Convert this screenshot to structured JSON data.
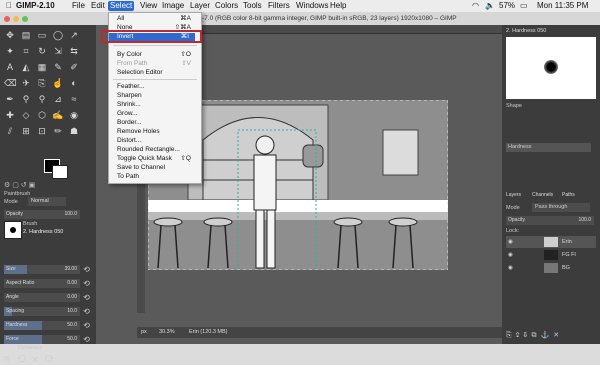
{
  "menubar": {
    "app": "GIMP-2.10",
    "items": [
      "File",
      "Edit",
      "Select",
      "View",
      "Image",
      "Layer",
      "Colors",
      "Tools",
      "Filters",
      "Windows",
      "Help"
    ],
    "active": "Select",
    "battery": "57%",
    "clock": "Mon 11:35 PM"
  },
  "titlebar": {
    "title": "-7.0 (RGB color 8-bit gamma integer, GIMP built-in sRGB, 23 layers) 1920x1080 – GIMP"
  },
  "select_menu": [
    {
      "label": "All",
      "shortcut": "⌘A"
    },
    {
      "label": "None",
      "shortcut": "⇧⌘A"
    },
    {
      "label": "Invert",
      "shortcut": "⌘I",
      "highlighted": true
    },
    {
      "label": "By Color",
      "shortcut": "⇧O"
    },
    {
      "label": "From Path",
      "shortcut": "⇧V",
      "disabled": true
    },
    {
      "label": "Selection Editor"
    },
    {
      "label": "Feather..."
    },
    {
      "label": "Sharpen"
    },
    {
      "label": "Shrink..."
    },
    {
      "label": "Grow..."
    },
    {
      "label": "Border..."
    },
    {
      "label": "Remove Holes"
    },
    {
      "label": "Distort..."
    },
    {
      "label": "Rounded Rectangle..."
    },
    {
      "label": "Toggle Quick Mask",
      "shortcut": "⇧Q"
    },
    {
      "label": "Save to Channel"
    },
    {
      "label": "To Path"
    }
  ],
  "tool_options": {
    "title": "Paintbrush",
    "mode_label": "Mode",
    "mode_value": "Normal",
    "opacity_label": "Opacity",
    "opacity_value": "100.0",
    "brush_label": "Brush",
    "brush_value": "2. Hardness 050",
    "rows": [
      {
        "label": "Size",
        "value": "39.00",
        "level": 0.3
      },
      {
        "label": "Aspect Ratio",
        "value": "0.00",
        "level": 0.0
      },
      {
        "label": "Angle",
        "value": "0.00",
        "level": 0.0
      },
      {
        "label": "Spacing",
        "value": "10.0",
        "level": 0.1
      },
      {
        "label": "Hardness",
        "value": "50.0",
        "level": 0.5
      },
      {
        "label": "Force",
        "value": "50.0",
        "level": 0.5
      }
    ],
    "dynamics_label": "Dynamics"
  },
  "brushes_panel": {
    "title": "2. Hardness 050",
    "shape_label": "Shape",
    "hardness_label": "Hardness"
  },
  "layers_panel": {
    "tabs": [
      "Layers",
      "Channels",
      "Paths"
    ],
    "mode_label": "Mode",
    "mode_value": "Pass through",
    "opacity_label": "Opacity",
    "opacity_value": "100.0",
    "lock_label": "Lock:",
    "layers": [
      {
        "name": "Erin"
      },
      {
        "name": "FG Fl"
      },
      {
        "name": "BG"
      }
    ]
  },
  "statusbar": {
    "unit": "px",
    "zoom": "30.3%",
    "info": "Erin (120.3 MB)"
  }
}
